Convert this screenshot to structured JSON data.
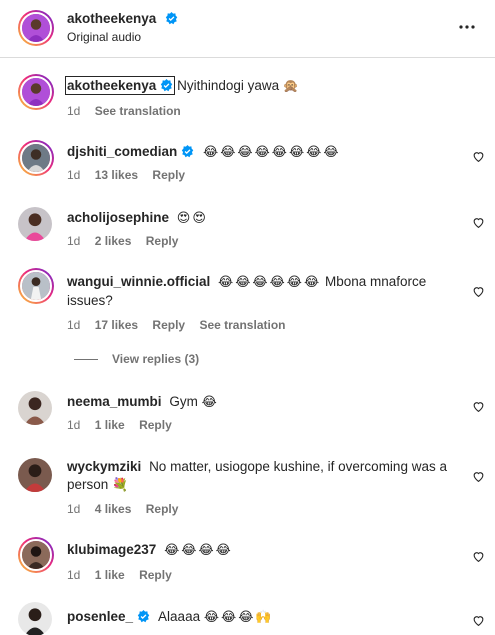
{
  "header": {
    "username": "akotheekenya",
    "subtitle": "Original audio"
  },
  "comments": [
    {
      "user": "akotheekenya",
      "verified": true,
      "text": "Nyithindogi yawa",
      "emoji": "🙊",
      "time": "1d",
      "likes": "",
      "reply": "",
      "translate": "See translation",
      "heart": false
    },
    {
      "user": "djshiti_comedian",
      "verified": true,
      "text": "",
      "emoji": "😂😂😂😂😂😂😂😂",
      "time": "1d",
      "likes": "13 likes",
      "reply": "Reply",
      "translate": "",
      "heart": true
    },
    {
      "user": "acholijosephine",
      "verified": false,
      "text": "",
      "emoji": "😍😍",
      "time": "1d",
      "likes": "2 likes",
      "reply": "Reply",
      "translate": "",
      "heart": true
    },
    {
      "user": "wangui_winnie.official",
      "verified": false,
      "text": "Mbona mnaforce issues?",
      "emoji": "😂😂😂😂😂😂",
      "time": "1d",
      "likes": "17 likes",
      "reply": "Reply",
      "translate": "See translation",
      "heart": true
    },
    {
      "user": "neema_mumbi",
      "verified": false,
      "text": "Gym",
      "emoji": "😂",
      "time": "1d",
      "likes": "1 like",
      "reply": "Reply",
      "translate": "",
      "heart": true
    },
    {
      "user": "wyckymziki",
      "verified": false,
      "text": "No matter, usiogope kushine, if overcoming was a person",
      "emoji": "💐",
      "time": "1d",
      "likes": "4 likes",
      "reply": "Reply",
      "translate": "",
      "heart": true
    },
    {
      "user": "klubimage237",
      "verified": false,
      "text": "",
      "emoji": "😂😂😂😂",
      "time": "1d",
      "likes": "1 like",
      "reply": "Reply",
      "translate": "",
      "heart": true
    },
    {
      "user": "posenlee_",
      "verified": true,
      "text": "Alaaaa",
      "emoji": "😂😂😂🙌",
      "time": "",
      "likes": "",
      "reply": "",
      "translate": "",
      "heart": true
    }
  ],
  "view_replies": "View replies (3)",
  "colors": {
    "verified": "#0095f6",
    "muted": "#737373",
    "text": "#262626"
  },
  "icons": {
    "verified": "verified-badge-icon",
    "heart": "heart-icon",
    "more": "more-options-icon"
  }
}
